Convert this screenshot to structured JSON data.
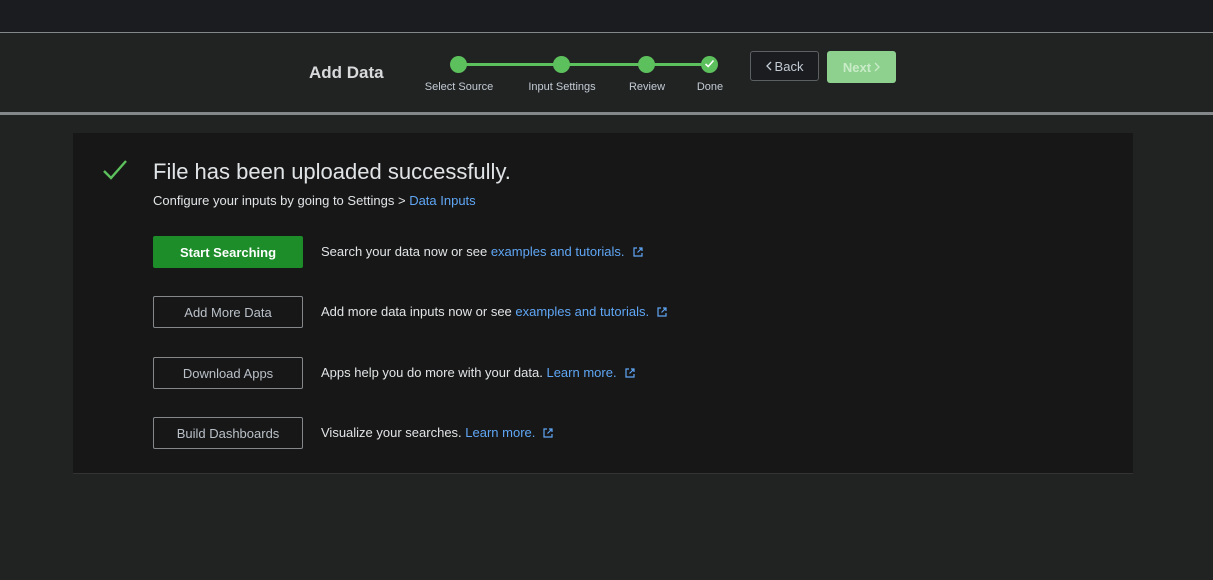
{
  "header": {
    "title": "Add Data",
    "steps": [
      {
        "label": "Select Source"
      },
      {
        "label": "Input Settings"
      },
      {
        "label": "Review"
      },
      {
        "label": "Done"
      }
    ],
    "back_label": "Back",
    "next_label": "Next"
  },
  "main": {
    "title": "File has been uploaded successfully.",
    "subtitle_prefix": "Configure your inputs by going to Settings > ",
    "subtitle_link": "Data Inputs",
    "actions": [
      {
        "button": "Start Searching",
        "text": "Search your data now or see ",
        "link": "examples and tutorials."
      },
      {
        "button": "Add More Data",
        "text": "Add more data inputs now or see ",
        "link": "examples and tutorials."
      },
      {
        "button": "Download Apps",
        "text": "Apps help you do more with your data. ",
        "link": "Learn more."
      },
      {
        "button": "Build Dashboards",
        "text": "Visualize your searches. ",
        "link": "Learn more."
      }
    ]
  },
  "colors": {
    "accent_green": "#5cc05c",
    "primary_button": "#1d8d2a",
    "link": "#5fa6f5"
  }
}
